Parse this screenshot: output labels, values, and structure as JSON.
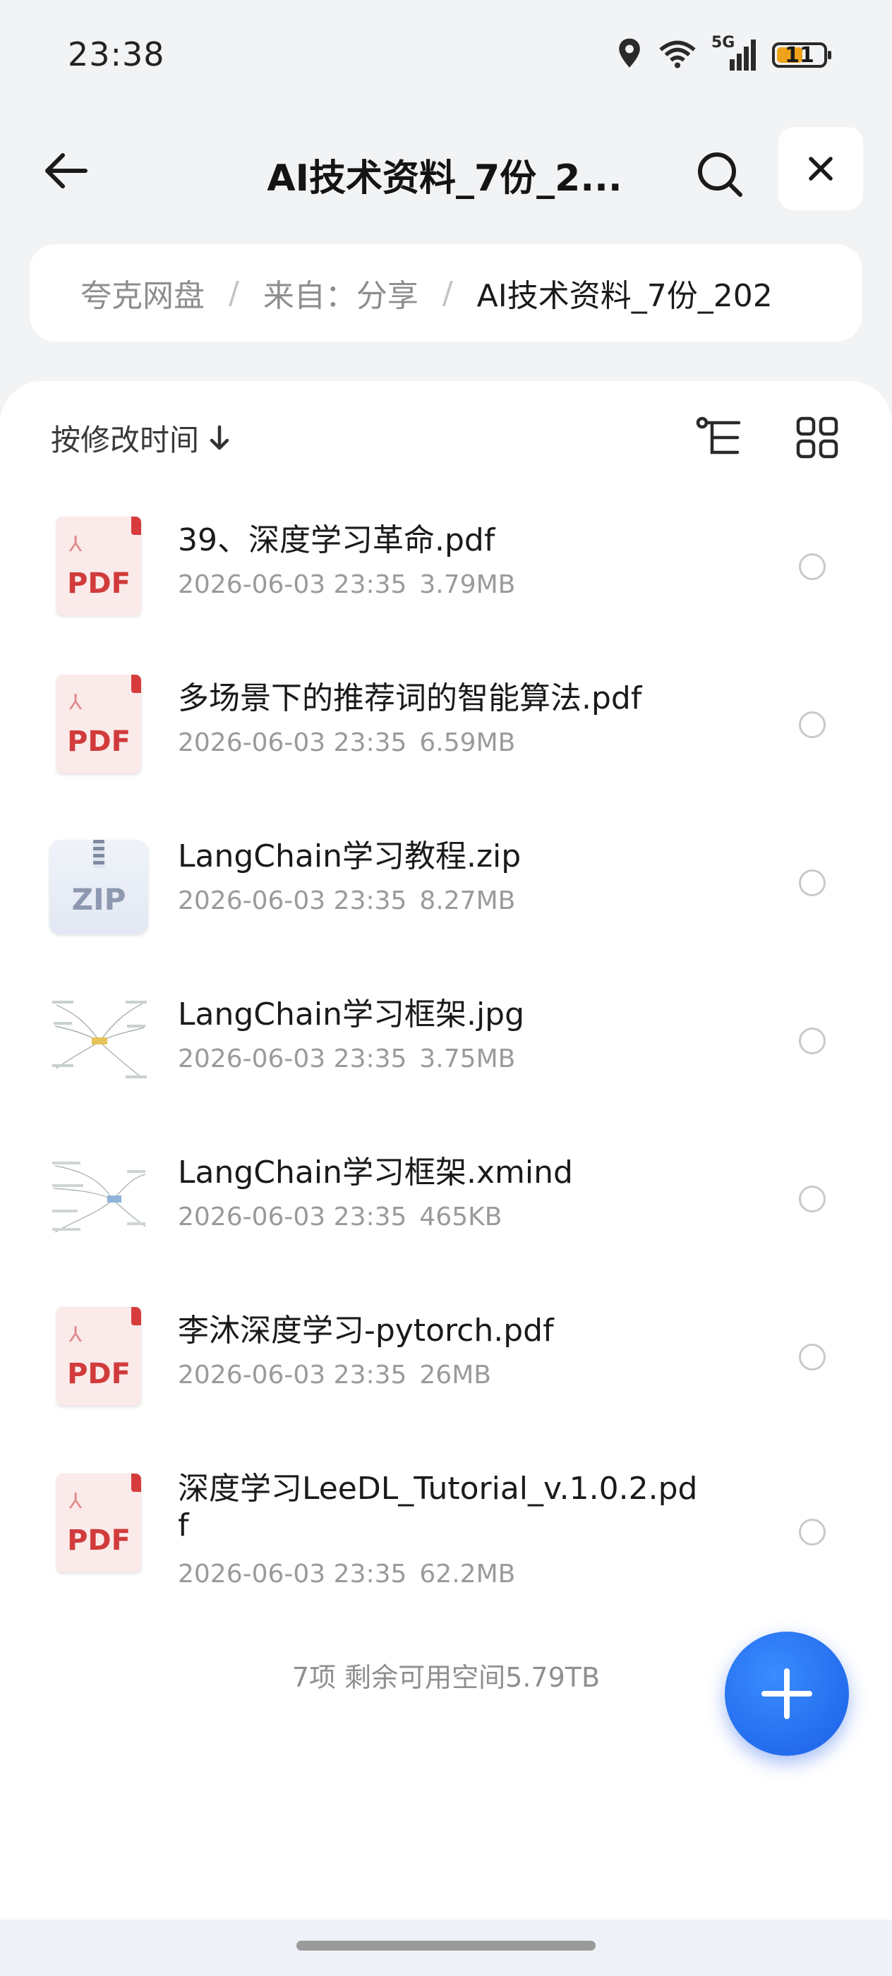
{
  "status_bar": {
    "time": "23:38",
    "network": "5G",
    "battery": "11",
    "battery_level": 0.11,
    "battery_color": "#f0a21a"
  },
  "header": {
    "title": "AI技术资料_7份_2..."
  },
  "breadcrumb": {
    "items": [
      "夸克网盘",
      "来自：分享",
      "AI技术资料_7份_202"
    ],
    "separator": "/"
  },
  "toolbar": {
    "sort_label": "按修改时间"
  },
  "files": [
    {
      "name": "39、深度学习革命.pdf",
      "date": "2026-06-03 23:35",
      "size": "3.79MB",
      "type": "pdf",
      "thumb_label": "PDF"
    },
    {
      "name": "多场景下的推荐词的智能算法.pdf",
      "date": "2026-06-03 23:35",
      "size": "6.59MB",
      "type": "pdf",
      "thumb_label": "PDF"
    },
    {
      "name": "LangChain学习教程.zip",
      "date": "2026-06-03 23:35",
      "size": "8.27MB",
      "type": "zip",
      "thumb_label": "ZIP"
    },
    {
      "name": "LangChain学习框架.jpg",
      "date": "2026-06-03 23:35",
      "size": "3.75MB",
      "type": "jpg"
    },
    {
      "name": "LangChain学习框架.xmind",
      "date": "2026-06-03 23:35",
      "size": "465KB",
      "type": "xmind"
    },
    {
      "name": "李沐深度学习-pytorch.pdf",
      "date": "2026-06-03 23:35",
      "size": "26MB",
      "type": "pdf",
      "thumb_label": "PDF"
    },
    {
      "name": "深度学习LeeDL_Tutorial_v.1.0.2.pdf",
      "date": "2026-06-03 23:35",
      "size": "62.2MB",
      "type": "pdf",
      "thumb_label": "PDF"
    }
  ],
  "footer": {
    "summary": "7项 剩余可用空间5.79TB"
  },
  "colors": {
    "accent": "#1a5fe6",
    "pdf_red": "#d13b3b"
  }
}
